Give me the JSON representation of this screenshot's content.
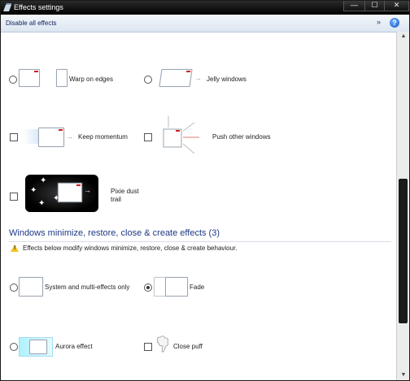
{
  "window": {
    "title": "Effects settings"
  },
  "window_controls": {
    "minimize": "—",
    "maximize": "☐",
    "close": "✕"
  },
  "toolbar": {
    "disable_all": "Disable all effects",
    "expand": "»",
    "help": "?"
  },
  "effects": {
    "warp_on_edges": {
      "label": "Warp on edges",
      "control": "radio",
      "checked": false
    },
    "jelly_windows": {
      "label": "Jelly windows",
      "control": "radio",
      "checked": false
    },
    "keep_momentum": {
      "label": "Keep momentum",
      "control": "checkbox",
      "checked": false
    },
    "push_other_windows": {
      "label": "Push other windows",
      "control": "checkbox",
      "checked": false
    },
    "pixie_dust_trail": {
      "label_line1": "Pixie dust",
      "label_line2": "trail",
      "control": "checkbox",
      "checked": false
    }
  },
  "section": {
    "title": "Windows minimize, restore, close & create effects (3)",
    "warning": "Effects below modify windows minimize, restore, close & create behaviour."
  },
  "effects2": {
    "system_multi": {
      "label": "System and multi-effects only",
      "control": "radio",
      "checked": false
    },
    "fade": {
      "label": "Fade",
      "control": "radio",
      "checked": true
    },
    "aurora": {
      "label": "Aurora effect",
      "control": "radio",
      "checked": false
    },
    "close_puff": {
      "label": "Close puff",
      "control": "checkbox",
      "checked": false
    }
  },
  "icons": {
    "arrow": "→",
    "warning": "!",
    "star": "✦"
  },
  "colors": {
    "titlebar": "#000000",
    "section_title": "#1d3a84",
    "warning": "#f3c21f",
    "accent_red": "#d01e1e"
  }
}
